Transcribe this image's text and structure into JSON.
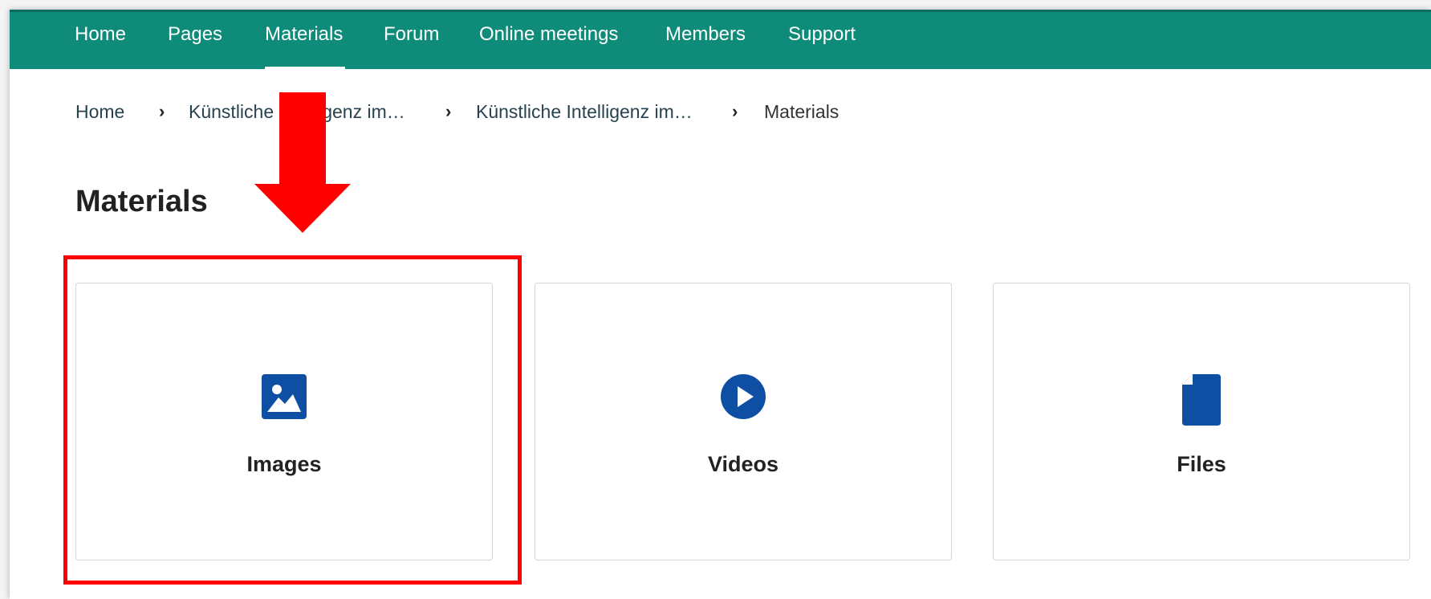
{
  "nav": {
    "items": [
      {
        "label": "Home"
      },
      {
        "label": "Pages"
      },
      {
        "label": "Materials"
      },
      {
        "label": "Forum"
      },
      {
        "label": "Online meetings"
      },
      {
        "label": "Members"
      },
      {
        "label": "Support"
      }
    ],
    "active": "Materials",
    "background": "#0e8b79"
  },
  "breadcrumb": {
    "items": [
      "Home",
      "Künstliche Intelligenz im…",
      "Künstliche Intelligenz im…"
    ],
    "current": "Materials"
  },
  "page": {
    "title": "Materials"
  },
  "cards": [
    {
      "label": "Images",
      "icon": "image-icon"
    },
    {
      "label": "Videos",
      "icon": "play-circle-icon"
    },
    {
      "label": "Files",
      "icon": "file-icon"
    }
  ],
  "colors": {
    "icon": "#0f4fa3",
    "highlight": "#ff0000"
  }
}
